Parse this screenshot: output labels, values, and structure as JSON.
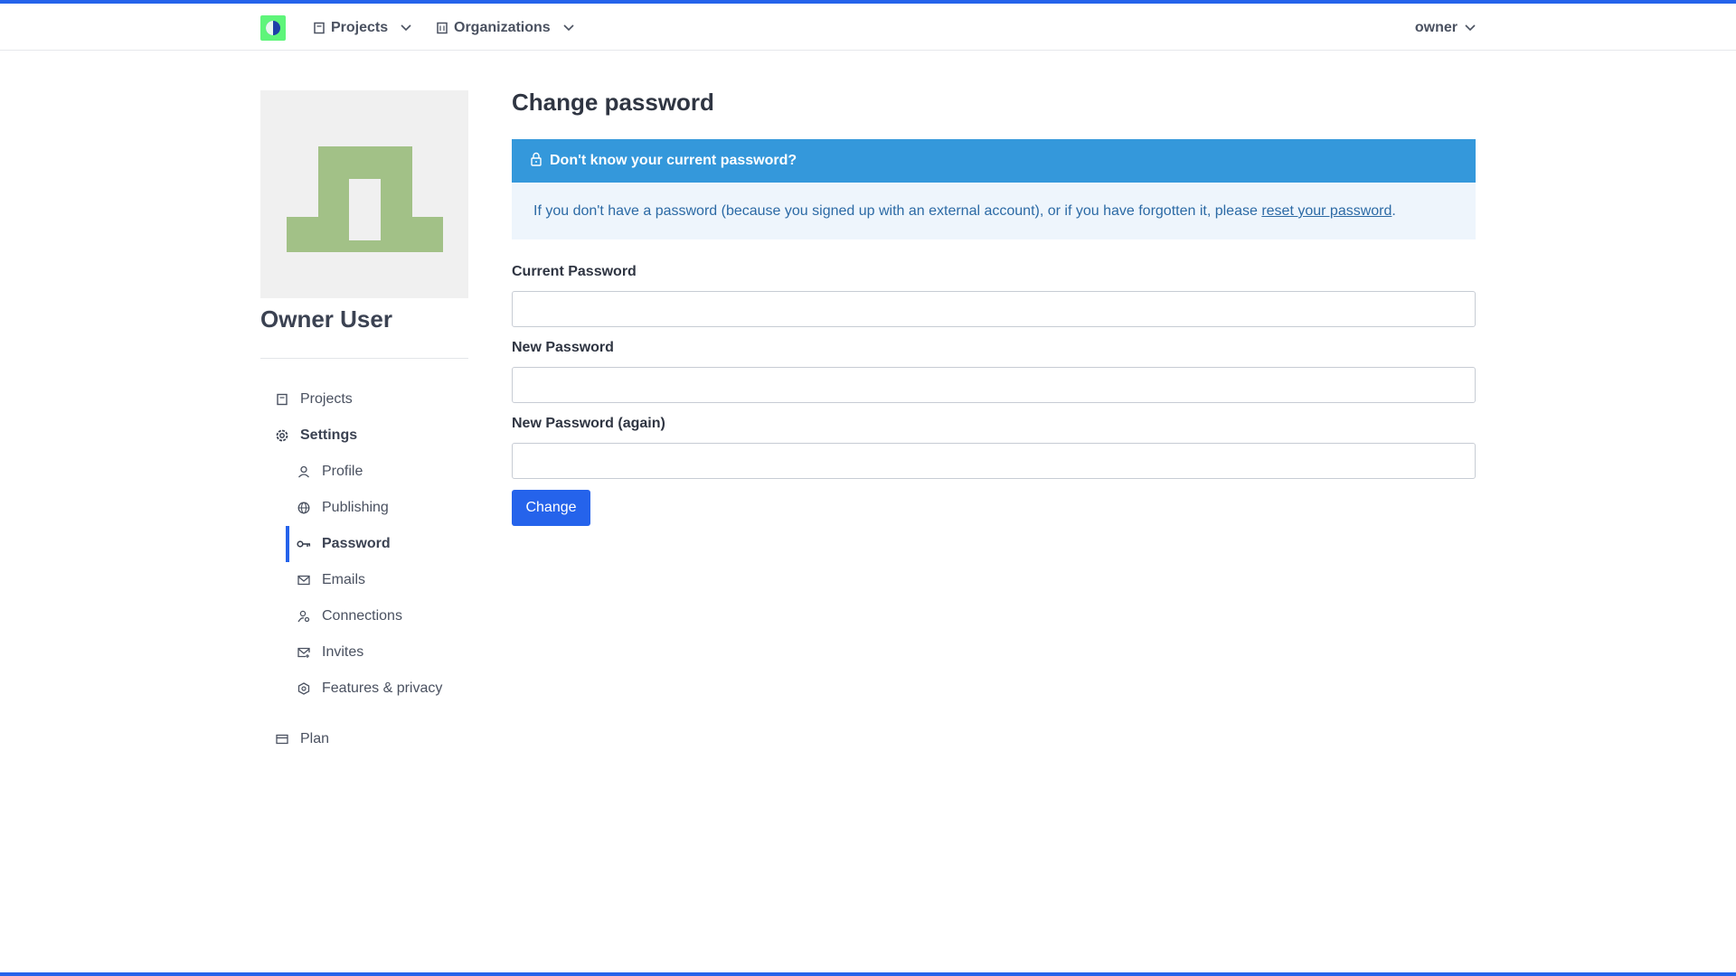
{
  "colors": {
    "accent": "#2563eb",
    "alert_header": "#3498db",
    "alert_body": "#eef5fc",
    "avatar": "#a2c187"
  },
  "navbar": {
    "logo_icon": "logo-icon",
    "projects_label": "Projects",
    "organizations_label": "Organizations",
    "user_label": "owner"
  },
  "profile": {
    "name": "Owner User"
  },
  "sidebar": {
    "items": [
      {
        "label": "Projects",
        "icon": "book-icon"
      },
      {
        "label": "Settings",
        "icon": "gear-icon"
      },
      {
        "label": "Profile",
        "icon": "user-icon"
      },
      {
        "label": "Publishing",
        "icon": "globe-icon"
      },
      {
        "label": "Password",
        "icon": "key-icon"
      },
      {
        "label": "Emails",
        "icon": "mail-icon"
      },
      {
        "label": "Connections",
        "icon": "user-link-icon"
      },
      {
        "label": "Invites",
        "icon": "mail-plus-icon"
      },
      {
        "label": "Features & privacy",
        "icon": "hexagon-icon"
      },
      {
        "label": "Plan",
        "icon": "card-icon"
      }
    ]
  },
  "main": {
    "title": "Change password",
    "alert": {
      "title": "Don't know your current password?",
      "body_prefix": "If you don't have a password (because you signed up with an external account), or if you have forgotten it, please ",
      "link_text": "reset your password",
      "body_suffix": "."
    },
    "fields": [
      {
        "label": "Current Password",
        "value": "",
        "placeholder": ""
      },
      {
        "label": "New Password",
        "value": "",
        "placeholder": ""
      },
      {
        "label": "New Password (again)",
        "value": "",
        "placeholder": ""
      }
    ],
    "submit_label": "Change"
  }
}
